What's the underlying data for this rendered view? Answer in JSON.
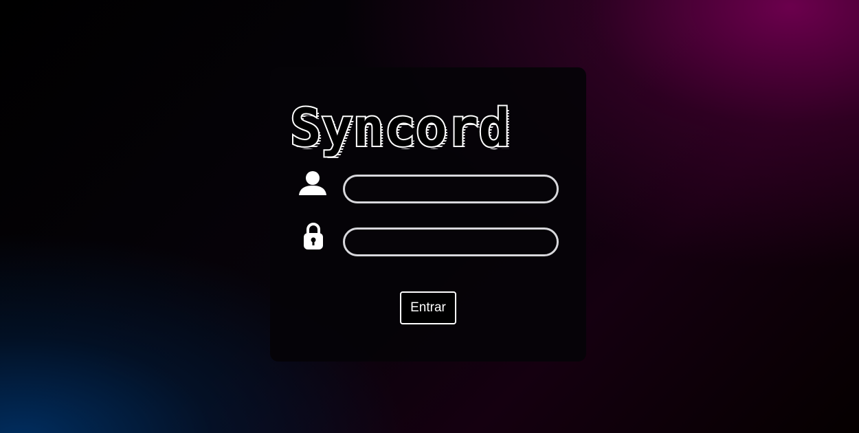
{
  "logo": {
    "text": "Syncord"
  },
  "icons": {
    "user": "user-icon",
    "lock": "lock-icon"
  },
  "form": {
    "username": {
      "value": "",
      "placeholder": ""
    },
    "password": {
      "value": "",
      "placeholder": ""
    },
    "submit_label": "Entrar"
  },
  "colors": {
    "card_background": "#050307",
    "field_border": "#d8d8dc",
    "text": "#ffffff",
    "bg_magenta": "#700050",
    "bg_blue": "#003064"
  }
}
